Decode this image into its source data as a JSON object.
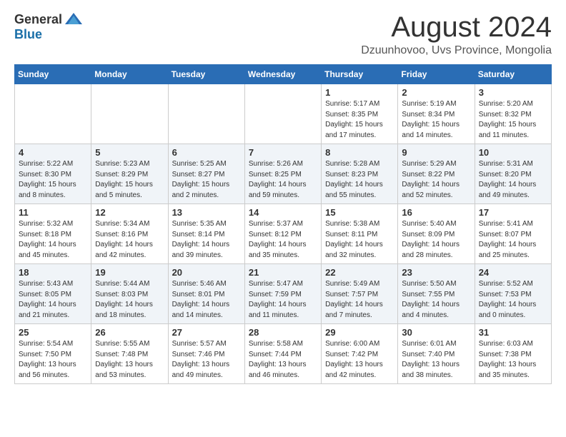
{
  "header": {
    "logo_general": "General",
    "logo_blue": "Blue",
    "month_year": "August 2024",
    "location": "Dzuunhovoo, Uvs Province, Mongolia"
  },
  "weekdays": [
    "Sunday",
    "Monday",
    "Tuesday",
    "Wednesday",
    "Thursday",
    "Friday",
    "Saturday"
  ],
  "weeks": [
    [
      {
        "day": "",
        "info": ""
      },
      {
        "day": "",
        "info": ""
      },
      {
        "day": "",
        "info": ""
      },
      {
        "day": "",
        "info": ""
      },
      {
        "day": "1",
        "info": "Sunrise: 5:17 AM\nSunset: 8:35 PM\nDaylight: 15 hours\nand 17 minutes."
      },
      {
        "day": "2",
        "info": "Sunrise: 5:19 AM\nSunset: 8:34 PM\nDaylight: 15 hours\nand 14 minutes."
      },
      {
        "day": "3",
        "info": "Sunrise: 5:20 AM\nSunset: 8:32 PM\nDaylight: 15 hours\nand 11 minutes."
      }
    ],
    [
      {
        "day": "4",
        "info": "Sunrise: 5:22 AM\nSunset: 8:30 PM\nDaylight: 15 hours\nand 8 minutes."
      },
      {
        "day": "5",
        "info": "Sunrise: 5:23 AM\nSunset: 8:29 PM\nDaylight: 15 hours\nand 5 minutes."
      },
      {
        "day": "6",
        "info": "Sunrise: 5:25 AM\nSunset: 8:27 PM\nDaylight: 15 hours\nand 2 minutes."
      },
      {
        "day": "7",
        "info": "Sunrise: 5:26 AM\nSunset: 8:25 PM\nDaylight: 14 hours\nand 59 minutes."
      },
      {
        "day": "8",
        "info": "Sunrise: 5:28 AM\nSunset: 8:23 PM\nDaylight: 14 hours\nand 55 minutes."
      },
      {
        "day": "9",
        "info": "Sunrise: 5:29 AM\nSunset: 8:22 PM\nDaylight: 14 hours\nand 52 minutes."
      },
      {
        "day": "10",
        "info": "Sunrise: 5:31 AM\nSunset: 8:20 PM\nDaylight: 14 hours\nand 49 minutes."
      }
    ],
    [
      {
        "day": "11",
        "info": "Sunrise: 5:32 AM\nSunset: 8:18 PM\nDaylight: 14 hours\nand 45 minutes."
      },
      {
        "day": "12",
        "info": "Sunrise: 5:34 AM\nSunset: 8:16 PM\nDaylight: 14 hours\nand 42 minutes."
      },
      {
        "day": "13",
        "info": "Sunrise: 5:35 AM\nSunset: 8:14 PM\nDaylight: 14 hours\nand 39 minutes."
      },
      {
        "day": "14",
        "info": "Sunrise: 5:37 AM\nSunset: 8:12 PM\nDaylight: 14 hours\nand 35 minutes."
      },
      {
        "day": "15",
        "info": "Sunrise: 5:38 AM\nSunset: 8:11 PM\nDaylight: 14 hours\nand 32 minutes."
      },
      {
        "day": "16",
        "info": "Sunrise: 5:40 AM\nSunset: 8:09 PM\nDaylight: 14 hours\nand 28 minutes."
      },
      {
        "day": "17",
        "info": "Sunrise: 5:41 AM\nSunset: 8:07 PM\nDaylight: 14 hours\nand 25 minutes."
      }
    ],
    [
      {
        "day": "18",
        "info": "Sunrise: 5:43 AM\nSunset: 8:05 PM\nDaylight: 14 hours\nand 21 minutes."
      },
      {
        "day": "19",
        "info": "Sunrise: 5:44 AM\nSunset: 8:03 PM\nDaylight: 14 hours\nand 18 minutes."
      },
      {
        "day": "20",
        "info": "Sunrise: 5:46 AM\nSunset: 8:01 PM\nDaylight: 14 hours\nand 14 minutes."
      },
      {
        "day": "21",
        "info": "Sunrise: 5:47 AM\nSunset: 7:59 PM\nDaylight: 14 hours\nand 11 minutes."
      },
      {
        "day": "22",
        "info": "Sunrise: 5:49 AM\nSunset: 7:57 PM\nDaylight: 14 hours\nand 7 minutes."
      },
      {
        "day": "23",
        "info": "Sunrise: 5:50 AM\nSunset: 7:55 PM\nDaylight: 14 hours\nand 4 minutes."
      },
      {
        "day": "24",
        "info": "Sunrise: 5:52 AM\nSunset: 7:53 PM\nDaylight: 14 hours\nand 0 minutes."
      }
    ],
    [
      {
        "day": "25",
        "info": "Sunrise: 5:54 AM\nSunset: 7:50 PM\nDaylight: 13 hours\nand 56 minutes."
      },
      {
        "day": "26",
        "info": "Sunrise: 5:55 AM\nSunset: 7:48 PM\nDaylight: 13 hours\nand 53 minutes."
      },
      {
        "day": "27",
        "info": "Sunrise: 5:57 AM\nSunset: 7:46 PM\nDaylight: 13 hours\nand 49 minutes."
      },
      {
        "day": "28",
        "info": "Sunrise: 5:58 AM\nSunset: 7:44 PM\nDaylight: 13 hours\nand 46 minutes."
      },
      {
        "day": "29",
        "info": "Sunrise: 6:00 AM\nSunset: 7:42 PM\nDaylight: 13 hours\nand 42 minutes."
      },
      {
        "day": "30",
        "info": "Sunrise: 6:01 AM\nSunset: 7:40 PM\nDaylight: 13 hours\nand 38 minutes."
      },
      {
        "day": "31",
        "info": "Sunrise: 6:03 AM\nSunset: 7:38 PM\nDaylight: 13 hours\nand 35 minutes."
      }
    ]
  ]
}
